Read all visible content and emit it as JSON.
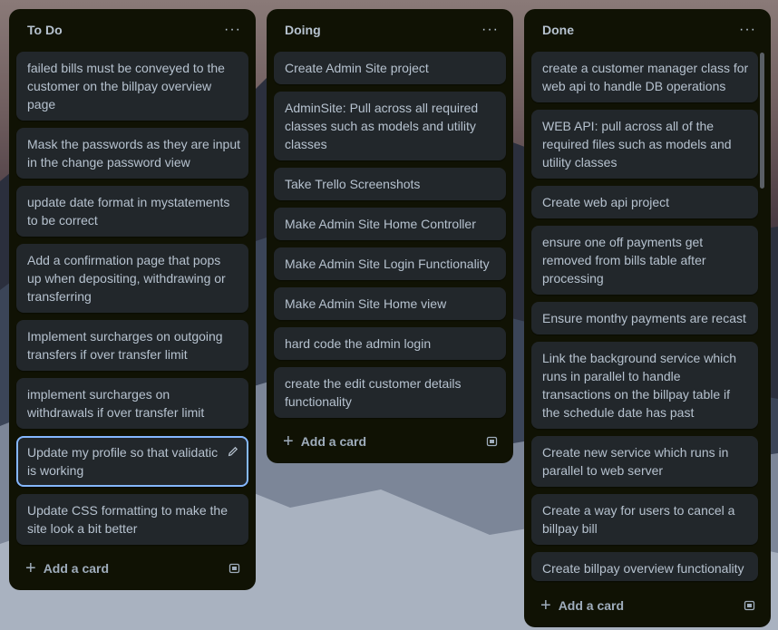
{
  "lists": [
    {
      "title": "To Do",
      "add_label": "Add a card",
      "cards": [
        {
          "lines": [
            "failed bills must be conveyed to the",
            "customer on the billpay overview",
            "page"
          ]
        },
        {
          "lines": [
            "Mask the passwords as they are input",
            "in the change password view"
          ]
        },
        {
          "lines": [
            "update date format in mystatements",
            "to be correct"
          ]
        },
        {
          "lines": [
            "Add a confirmation page that pops",
            "up when depositing, withdrawing or",
            "transferring"
          ]
        },
        {
          "lines": [
            "Implement surcharges on outgoing",
            "transfers if over transfer limit"
          ]
        },
        {
          "lines": [
            "implement surcharges on",
            "withdrawals if over transfer limit"
          ]
        },
        {
          "lines": [
            "Update my profile so that validatic",
            "is working"
          ]
        },
        {
          "lines": [
            "Update CSS formatting to make the",
            "site look a bit better"
          ]
        }
      ]
    },
    {
      "title": "Doing",
      "add_label": "Add a card",
      "cards": [
        {
          "lines": [
            "Create Admin Site project"
          ]
        },
        {
          "lines": [
            "AdminSite: Pull across all required",
            "classes such as models and utility",
            "classes"
          ]
        },
        {
          "lines": [
            "Take Trello Screenshots"
          ]
        },
        {
          "lines": [
            "Make Admin Site Home Controller"
          ]
        },
        {
          "lines": [
            "Make Admin Site Login Functionality"
          ]
        },
        {
          "lines": [
            "Make Admin Site Home view"
          ]
        },
        {
          "lines": [
            "hard code the admin login"
          ]
        },
        {
          "lines": [
            "create the edit customer details",
            "functionality"
          ]
        }
      ]
    },
    {
      "title": "Done",
      "add_label": "Add a card",
      "cards": [
        {
          "lines": [
            "create a customer manager class for",
            "web api to handle DB operations"
          ]
        },
        {
          "lines": [
            "WEB API: pull across all of the",
            "required files such as models and",
            "utility classes"
          ]
        },
        {
          "lines": [
            "Create web api project"
          ]
        },
        {
          "lines": [
            "ensure one off payments get",
            "removed from bills table after",
            "processing"
          ]
        },
        {
          "lines": [
            "Ensure monthy payments are recast"
          ]
        },
        {
          "lines": [
            "Link the background service which",
            "runs in parallel to handle",
            "transactions on the billpay table if",
            "the schedule date has past"
          ]
        },
        {
          "lines": [
            "Create new service which runs in",
            "parallel to web server"
          ]
        },
        {
          "lines": [
            "Create a way for users to cancel a",
            "billpay bill"
          ]
        },
        {
          "lines": [
            "Create billpay overview functionality"
          ]
        }
      ]
    }
  ],
  "icons": {
    "list_menu": "more-horizontal-icon",
    "add": "plus-icon",
    "template": "card-template-icon",
    "edit": "pencil-icon"
  },
  "colors": {
    "list_bg": "#101204",
    "card_bg": "#22272b",
    "text": "#b6c2cf",
    "focus_outline": "#85b8ff"
  }
}
